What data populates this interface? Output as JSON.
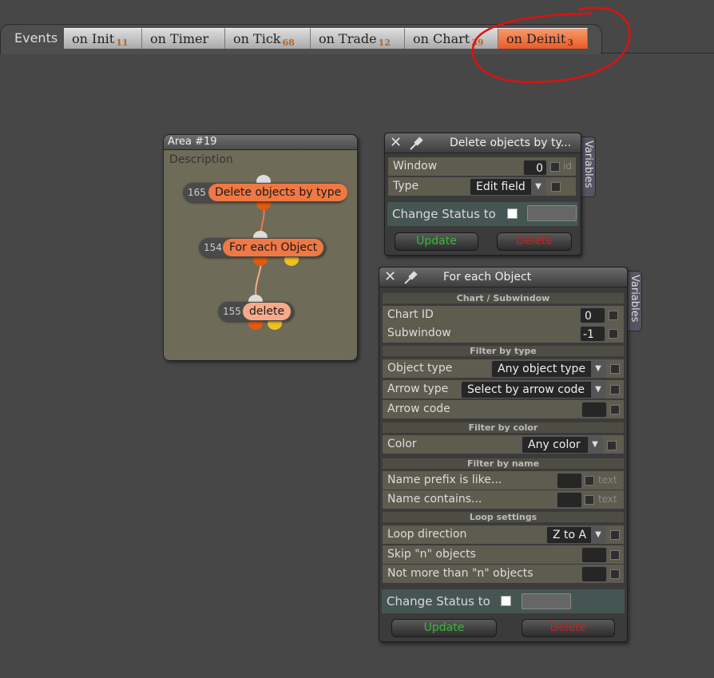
{
  "events": {
    "label": "Events",
    "tabs": [
      {
        "label": "on Init",
        "count": "11",
        "active": false
      },
      {
        "label": "on Timer",
        "count": "",
        "active": false
      },
      {
        "label": "on Tick",
        "count": "68",
        "active": false
      },
      {
        "label": "on Trade",
        "count": "12",
        "active": false
      },
      {
        "label": "on Chart",
        "count": "39",
        "active": false
      },
      {
        "label": "on Deinit",
        "count": "3",
        "active": true
      }
    ]
  },
  "area": {
    "title": "Area #19",
    "description": "Description",
    "nodes": [
      {
        "id": "165",
        "label": "Delete objects by type"
      },
      {
        "id": "154",
        "label": "For each Object"
      },
      {
        "id": "155",
        "label": "delete"
      }
    ]
  },
  "panel1": {
    "title": "Delete objects by ty...",
    "variables_tab": "Variables",
    "window_label": "Window",
    "window_value": "0",
    "window_id_hint": "id",
    "type_label": "Type",
    "type_value": "Edit field",
    "status_label": "Change Status to",
    "update_label": "Update",
    "delete_label": "Delete"
  },
  "panel2": {
    "title": "For each Object",
    "variables_tab": "Variables",
    "sec_chart": "Chart / Subwindow",
    "chart_id_label": "Chart ID",
    "chart_id_value": "0",
    "subwindow_label": "Subwindow",
    "subwindow_value": "-1",
    "sec_type": "Filter by type",
    "object_type_label": "Object type",
    "object_type_value": "Any object type",
    "arrow_type_label": "Arrow type",
    "arrow_type_value": "Select by arrow code",
    "arrow_code_label": "Arrow code",
    "sec_color": "Filter by color",
    "color_label": "Color",
    "color_value": "Any color",
    "sec_name": "Filter by name",
    "name_prefix_label": "Name prefix is like...",
    "name_contains_label": "Name contains...",
    "text_hint": "text",
    "sec_loop": "Loop settings",
    "loop_direction_label": "Loop direction",
    "loop_direction_value": "Z to A",
    "skip_label": "Skip \"n\" objects",
    "not_more_label": "Not more than \"n\" objects",
    "status_label": "Change Status to",
    "update_label": "Update",
    "delete_label": "Delete"
  },
  "colors": {
    "tab_active": "#e95b26",
    "node_label": "#f07844",
    "node_light": "#f7a98a",
    "annotation": "#e01010",
    "update": "#37b837",
    "delete": "#c82020"
  }
}
